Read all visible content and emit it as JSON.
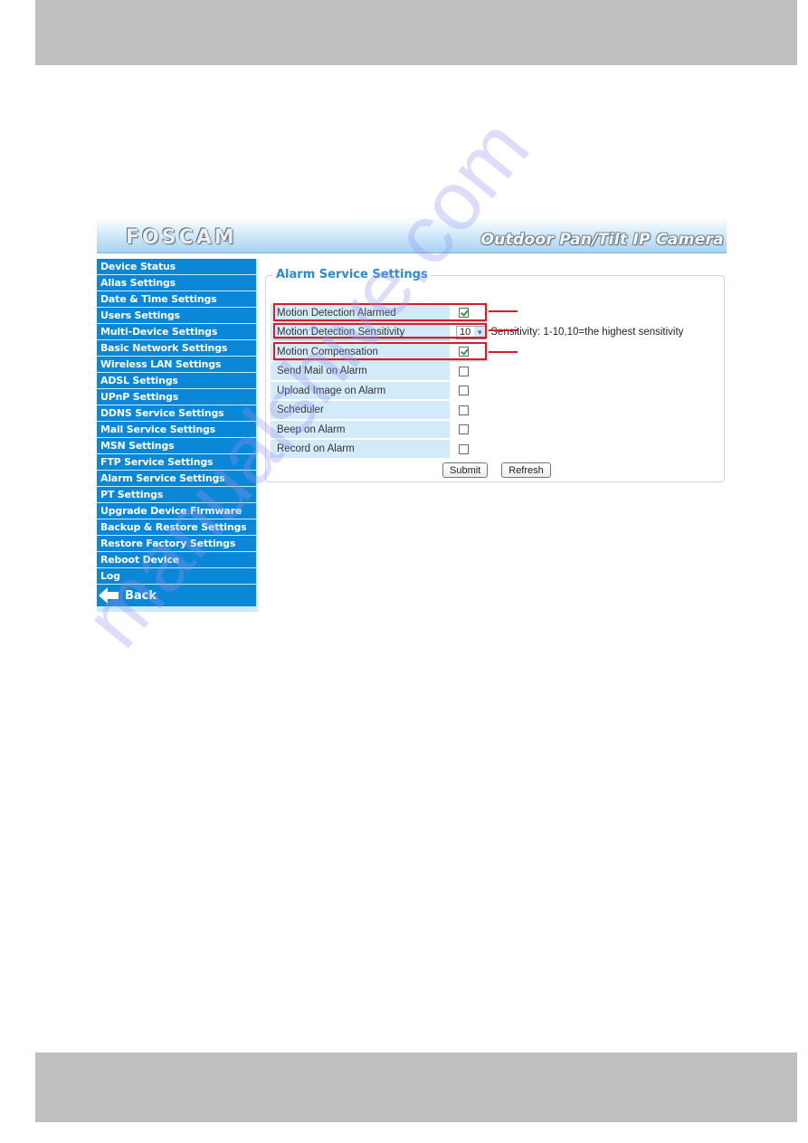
{
  "header": {
    "logo": "FOSCAM",
    "product_title": "Outdoor Pan/Tilt IP Camera"
  },
  "sidebar": {
    "items": [
      {
        "label": "Device Status"
      },
      {
        "label": "Alias Settings"
      },
      {
        "label": "Date & Time Settings"
      },
      {
        "label": "Users Settings"
      },
      {
        "label": "Multi-Device Settings"
      },
      {
        "label": "Basic Network Settings"
      },
      {
        "label": "Wireless LAN Settings"
      },
      {
        "label": "ADSL Settings"
      },
      {
        "label": "UPnP Settings"
      },
      {
        "label": "DDNS Service Settings"
      },
      {
        "label": "Mail Service Settings"
      },
      {
        "label": "MSN Settings"
      },
      {
        "label": "FTP Service Settings"
      },
      {
        "label": "Alarm Service Settings"
      },
      {
        "label": "PT Settings"
      },
      {
        "label": "Upgrade Device Firmware"
      },
      {
        "label": "Backup & Restore Settings"
      },
      {
        "label": "Restore Factory Settings"
      },
      {
        "label": "Reboot Device"
      },
      {
        "label": "Log"
      }
    ],
    "back_label": "Back",
    "back_icon": "left-arrow-icon"
  },
  "panel": {
    "title": "Alarm Service Settings",
    "rows": [
      {
        "label": "Motion Detection Alarmed",
        "type": "checkbox",
        "checked": true,
        "highlighted": true
      },
      {
        "label": "Motion Detection Sensitivity",
        "type": "select",
        "value": "10",
        "hint": "Sensitivity: 1-10,10=the highest sensitivity",
        "highlighted": true
      },
      {
        "label": "Motion Compensation",
        "type": "checkbox",
        "checked": true,
        "highlighted": true
      },
      {
        "label": "Send Mail on Alarm",
        "type": "checkbox",
        "checked": false
      },
      {
        "label": "Upload Image on Alarm",
        "type": "checkbox",
        "checked": false
      },
      {
        "label": "Scheduler",
        "type": "checkbox",
        "checked": false
      },
      {
        "label": "Beep on Alarm",
        "type": "checkbox",
        "checked": false
      },
      {
        "label": "Record on Alarm",
        "type": "checkbox",
        "checked": false
      }
    ],
    "submit_label": "Submit",
    "refresh_label": "Refresh"
  },
  "watermark": "manualshive.com",
  "colors": {
    "nav_blue": "#0a87d6",
    "title_blue": "#2d8ad0",
    "highlight_red": "#d21f2b",
    "row_bg": "#d3ebf8",
    "page_bar_gray": "#bfbfbf"
  }
}
